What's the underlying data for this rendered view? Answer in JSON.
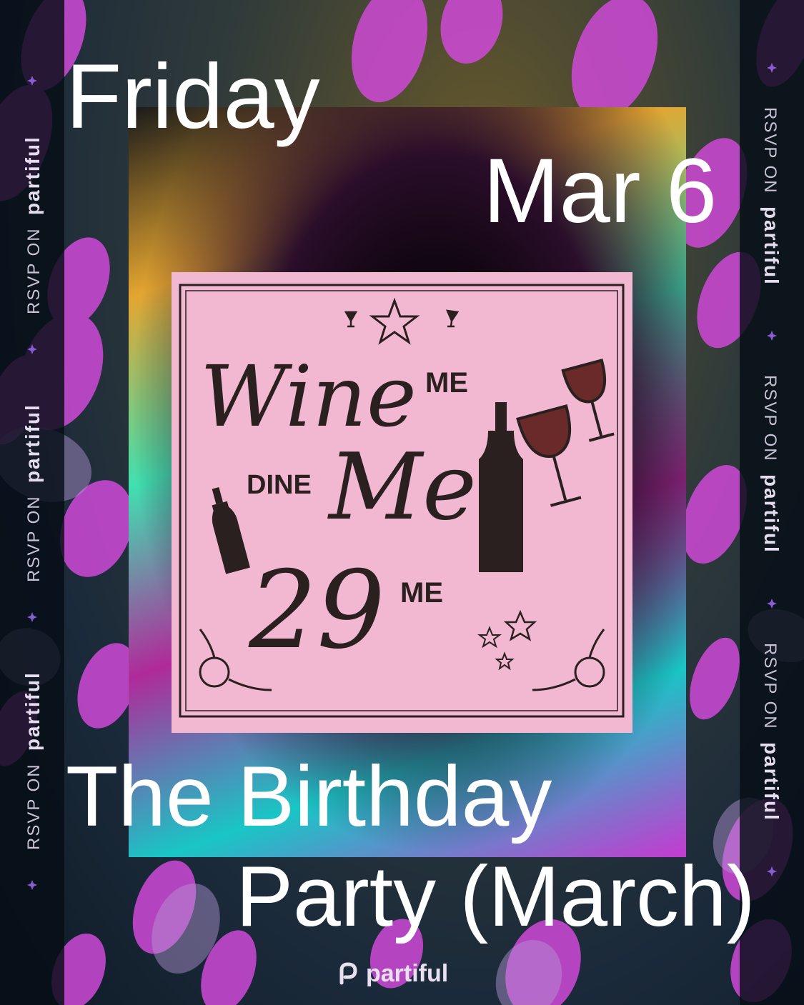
{
  "event": {
    "day": "Friday",
    "date": "Mar 6",
    "title_line1": "The Birthday",
    "title_line2": "Party (March)"
  },
  "poster": {
    "script_word1": "Wine",
    "script_word2": "Me",
    "number": "29",
    "label_me_top": "ME",
    "label_dine": "DINE",
    "label_me_bottom": "ME"
  },
  "side_banner": {
    "prefix": "RSVP ON",
    "brand": "partiful"
  },
  "footer": {
    "brand": "partiful"
  },
  "colors": {
    "accent": "#c53ad0",
    "poster_bg": "#f2b8d2",
    "ink": "#2b2020",
    "text": "#ffffff"
  }
}
